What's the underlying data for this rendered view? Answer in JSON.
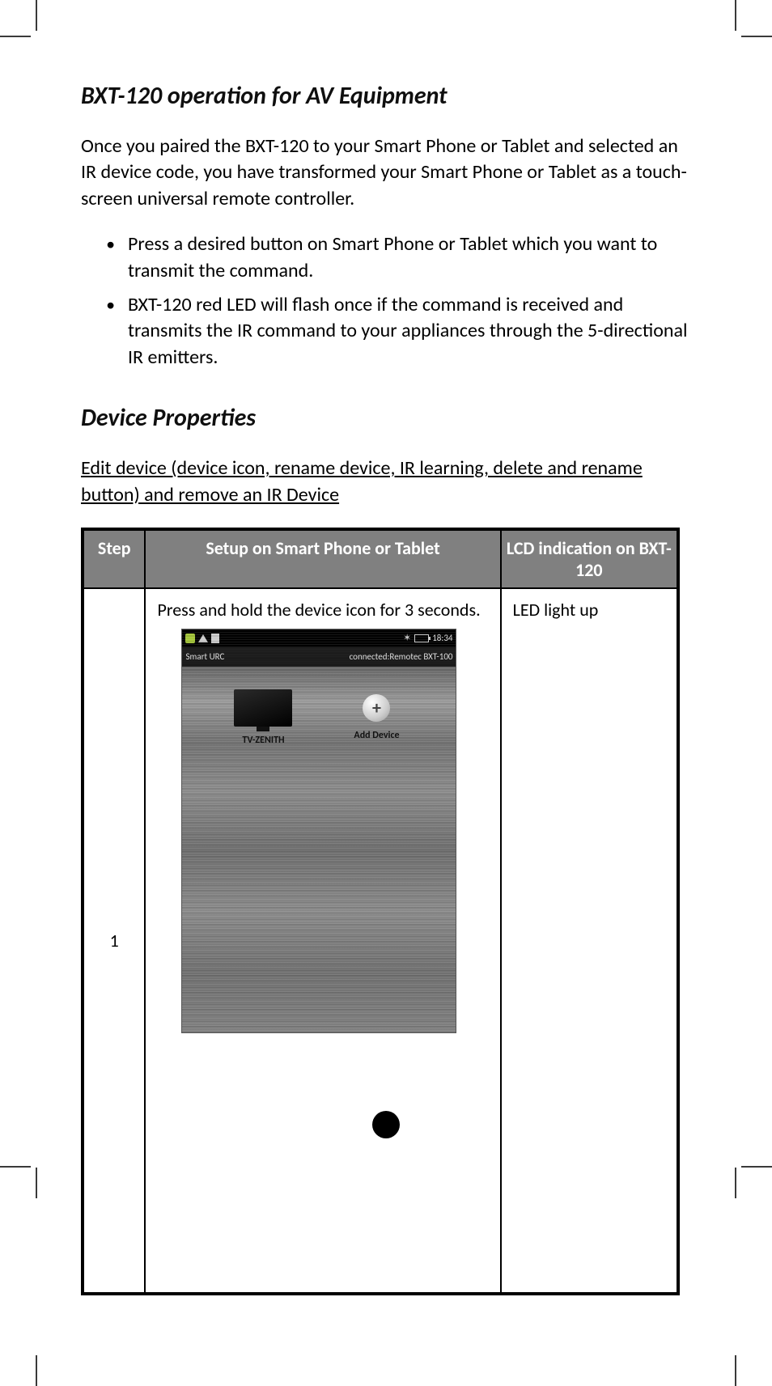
{
  "heading1": "BXT-120 operation for AV Equipment",
  "intro": "Once you paired the BXT-120 to your Smart Phone or Tablet and selected an IR device code, you have transformed your Smart Phone or Tablet as a touch-screen universal remote controller.",
  "bullets": [
    "Press a desired button on Smart Phone or Tablet which you want to transmit the command.",
    "BXT-120 red LED will flash once if the command is received and transmits the IR command to your appliances through the 5-directional IR emitters."
  ],
  "heading2": "Device Properties",
  "sub_underline": "Edit device (device icon, rename device, IR learning, delete and rename button) and remove an IR Device",
  "table": {
    "headers": {
      "step": "Step",
      "setup": "Setup on Smart Phone or Tablet",
      "lcd": "LCD indication on BXT-120"
    },
    "row": {
      "step": "1",
      "setup_text": "Press and hold the device icon for 3 seconds.",
      "lcd": "LED light up"
    }
  },
  "phone": {
    "time": "18:34",
    "app_name": "Smart URC",
    "conn": "connected:Remotec BXT-100",
    "dev1": "TV-ZENITH",
    "dev2": "Add Device",
    "plus": "+"
  }
}
